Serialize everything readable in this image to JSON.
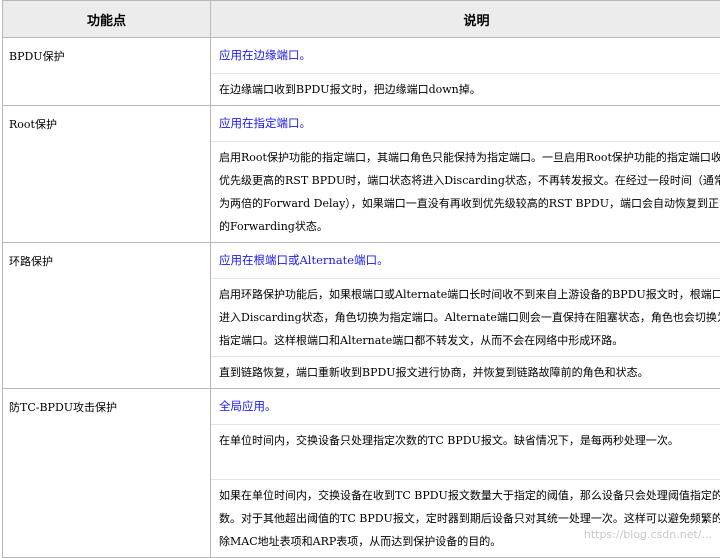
{
  "header": {
    "col1": "功能点",
    "col2": "说明"
  },
  "rows": [
    {
      "feature": "BPDU保护",
      "scope": "应用在边缘端口。",
      "paragraphs": [
        "在边缘端口收到BPDU报文时，把边缘端口down掉。"
      ]
    },
    {
      "feature": "Root保护",
      "scope": "应用在指定端口。",
      "paragraphs": [
        "启用Root保护功能的指定端口，其端口角色只能保持为指定端口。一旦启用Root保护功能的指定端口收到优先级更高的RST BPDU时，端口状态将进入Discarding状态，不再转发报文。在经过一段时间（通常为两倍的Forward Delay），如果端口一直没有再收到优先级较高的RST BPDU，端口会自动恢复到正常的Forwarding状态。"
      ]
    },
    {
      "feature": "环路保护",
      "scope": "应用在根端口或Alternate端口。",
      "paragraphs": [
        "启用环路保护功能后，如果根端口或Alternate端口长时间收不到来自上游设备的BPDU报文时，根端口会进入Discarding状态，角色切换为指定端口。Alternate端口则会一直保持在阻塞状态，角色也会切换为指定端口。这样根端口和Alternate端口都不转发文，从而不会在网络中形成环路。",
        "直到链路恢复，端口重新收到BPDU报文进行协商，并恢复到链路故障前的角色和状态。"
      ]
    },
    {
      "feature": "防TC-BPDU攻击保护",
      "scope": "全局应用。",
      "paragraphs": [
        "在单位时间内，交换设备只处理指定次数的TC BPDU报文。缺省情况下，是每两秒处理一次。",
        "如果在单位时间内，交换设备在收到TC BPDU报文数量大于指定的阈值，那么设备只会处理阈值指定的次数。对于其他超出阈值的TC BPDU报文，定时器到期后设备只对其统一处理一次。这样可以避免频繁的删除MAC地址表项和ARP表项，从而达到保护设备的目的。"
      ]
    }
  ],
  "watermark": "https://blog.csdn.net/..."
}
